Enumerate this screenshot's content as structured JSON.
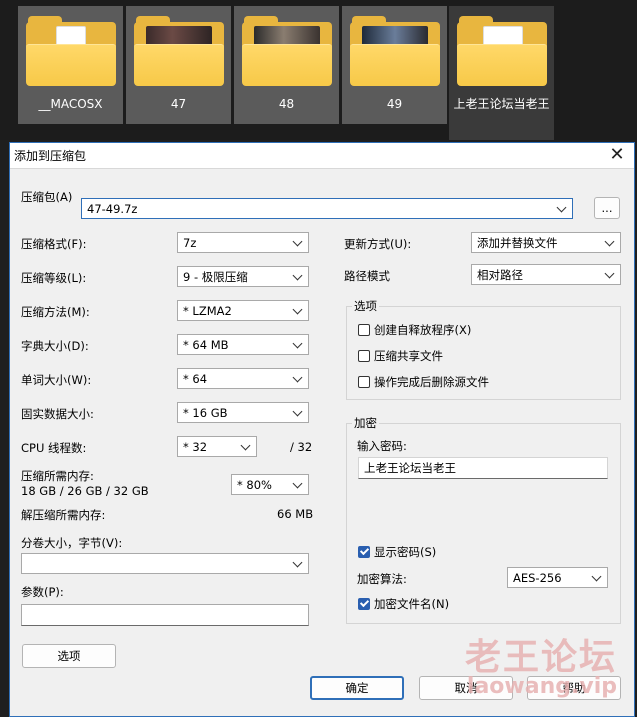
{
  "explorer": {
    "folders": [
      {
        "label": "__MACOSX",
        "icon": "folder-with-document-icon"
      },
      {
        "label": "47",
        "icon": "folder-with-photos-icon"
      },
      {
        "label": "48",
        "icon": "folder-with-photos-icon"
      },
      {
        "label": "49",
        "icon": "folder-with-photos-icon"
      },
      {
        "label": "上老王论坛当老王",
        "icon": "folder-with-image-icon"
      }
    ]
  },
  "dialog": {
    "title": "添加到压缩包",
    "close_glyph": "✕",
    "archive_label": "压缩包(A)",
    "archive_value": "47-49.7z",
    "browse_label": "...",
    "format_label": "压缩格式(F):",
    "format_value": "7z",
    "level_label": "压缩等级(L):",
    "level_value": "9 - 极限压缩",
    "method_label": "压缩方法(M):",
    "method_value": "* LZMA2",
    "dict_label": "字典大小(D):",
    "dict_value": "* 64 MB",
    "word_label": "单词大小(W):",
    "word_value": "* 64",
    "solid_label": "固实数据大小:",
    "solid_value": "* 16 GB",
    "threads_label": "CPU 线程数:",
    "threads_value": "* 32",
    "threads_max": "/ 32",
    "mem_label": "压缩所需内存:",
    "mem_detail": "18 GB / 26 GB / 32 GB",
    "mem_percent": "* 80%",
    "decomp_label": "解压缩所需内存:",
    "decomp_value": "66 MB",
    "volume_label": "分卷大小，字节(V):",
    "volume_value": "",
    "params_label": "参数(P):",
    "params_value": "",
    "options_button": "选项",
    "update_label": "更新方式(U):",
    "update_value": "添加并替换文件",
    "path_label": "路径模式",
    "path_value": "相对路径",
    "options_group": "选项",
    "opt_sfx": "创建自释放程序(X)",
    "opt_sfx_checked": false,
    "opt_shared": "压缩共享文件",
    "opt_shared_checked": false,
    "opt_delete": "操作完成后删除源文件",
    "opt_delete_checked": false,
    "encrypt_group": "加密",
    "password_label": "输入密码:",
    "password_value": "上老王论坛当老王",
    "show_password": "显示密码(S)",
    "show_password_checked": true,
    "enc_method_label": "加密算法:",
    "enc_method_value": "AES-256",
    "enc_names": "加密文件名(N)",
    "enc_names_checked": true,
    "ok_button": "确定",
    "cancel_button": "取消",
    "help_button": "帮助"
  },
  "watermark": {
    "text": "老王论坛",
    "url": "laowang.vip"
  },
  "colors": {
    "accent": "#2f6fb8",
    "folder": "#f7c948",
    "checkbox": "#2a5fb0"
  }
}
